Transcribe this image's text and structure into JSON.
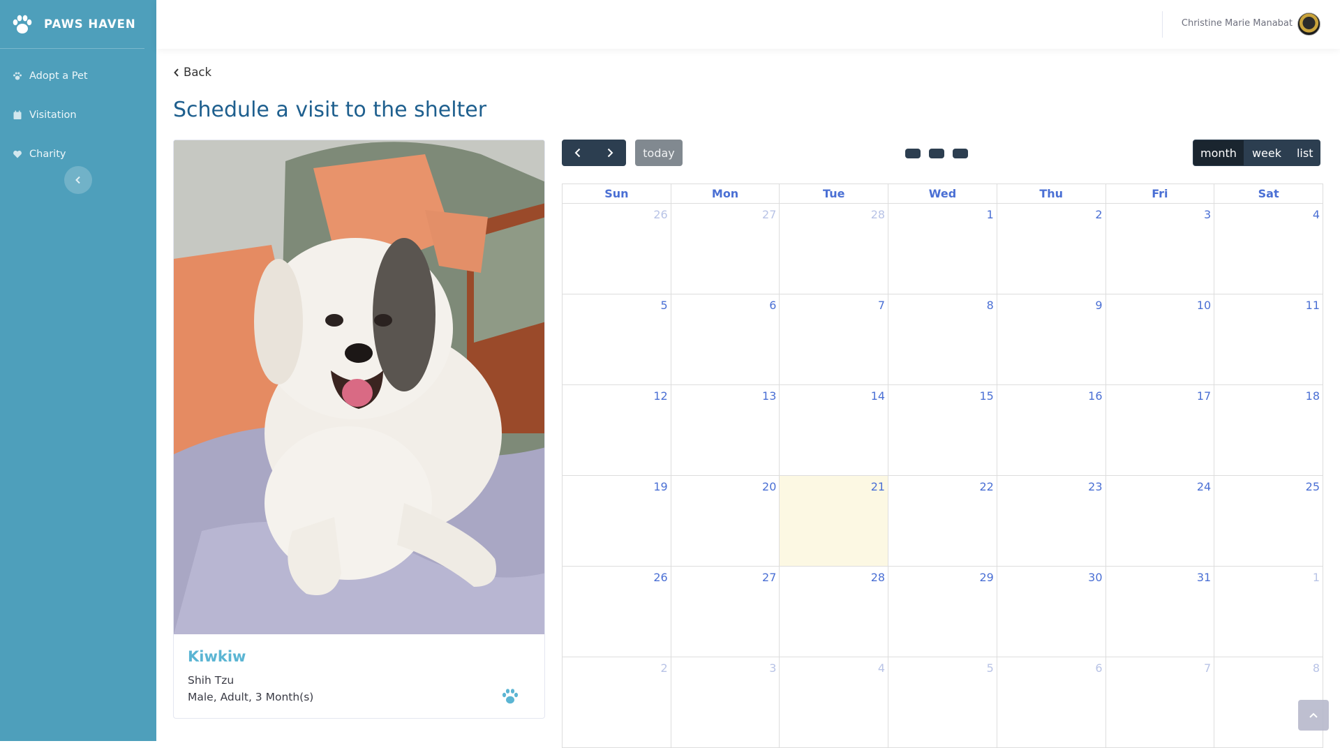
{
  "brand": {
    "name": "PAWS HAVEN",
    "icon": "paw-icon"
  },
  "sidebar": {
    "items": [
      {
        "label": "Adopt a Pet",
        "icon": "paw-icon"
      },
      {
        "label": "Visitation",
        "icon": "calendar-icon"
      },
      {
        "label": "Charity",
        "icon": "heart-icon"
      }
    ],
    "collapse_icon": "chevron-left-icon"
  },
  "topbar": {
    "user_name": "Christine Marie Manabat",
    "avatar_icon": "avatar"
  },
  "page": {
    "back_label": "Back",
    "title": "Schedule a visit to the shelter"
  },
  "pet": {
    "name": "Kiwkiw",
    "breed": "Shih Tzu",
    "details": "Male, Adult, 3 Month(s)",
    "icon": "paw-icon"
  },
  "calendar": {
    "today_label": "today",
    "views": [
      "month",
      "week",
      "list"
    ],
    "active_view": "month",
    "weekdays": [
      "Sun",
      "Mon",
      "Tue",
      "Wed",
      "Thu",
      "Fri",
      "Sat"
    ],
    "weeks": [
      [
        {
          "d": "26",
          "o": true
        },
        {
          "d": "27",
          "o": true
        },
        {
          "d": "28",
          "o": true
        },
        {
          "d": "1"
        },
        {
          "d": "2"
        },
        {
          "d": "3"
        },
        {
          "d": "4"
        }
      ],
      [
        {
          "d": "5"
        },
        {
          "d": "6"
        },
        {
          "d": "7"
        },
        {
          "d": "8"
        },
        {
          "d": "9"
        },
        {
          "d": "10"
        },
        {
          "d": "11"
        }
      ],
      [
        {
          "d": "12"
        },
        {
          "d": "13"
        },
        {
          "d": "14"
        },
        {
          "d": "15"
        },
        {
          "d": "16"
        },
        {
          "d": "17"
        },
        {
          "d": "18"
        }
      ],
      [
        {
          "d": "19"
        },
        {
          "d": "20"
        },
        {
          "d": "21",
          "t": true
        },
        {
          "d": "22"
        },
        {
          "d": "23"
        },
        {
          "d": "24"
        },
        {
          "d": "25"
        }
      ],
      [
        {
          "d": "26"
        },
        {
          "d": "27"
        },
        {
          "d": "28"
        },
        {
          "d": "29"
        },
        {
          "d": "30"
        },
        {
          "d": "31"
        },
        {
          "d": "1",
          "o": true
        }
      ],
      [
        {
          "d": "2",
          "o": true
        },
        {
          "d": "3",
          "o": true
        },
        {
          "d": "4",
          "o": true
        },
        {
          "d": "5",
          "o": true
        },
        {
          "d": "6",
          "o": true
        },
        {
          "d": "7",
          "o": true
        },
        {
          "d": "8",
          "o": true
        }
      ]
    ]
  },
  "colors": {
    "sidebar": "#4e9fbb",
    "title": "#1e5f8e",
    "accent": "#5bb5d3",
    "today_highlight": "#fcf8e3",
    "dark_button": "#2c3e50"
  }
}
